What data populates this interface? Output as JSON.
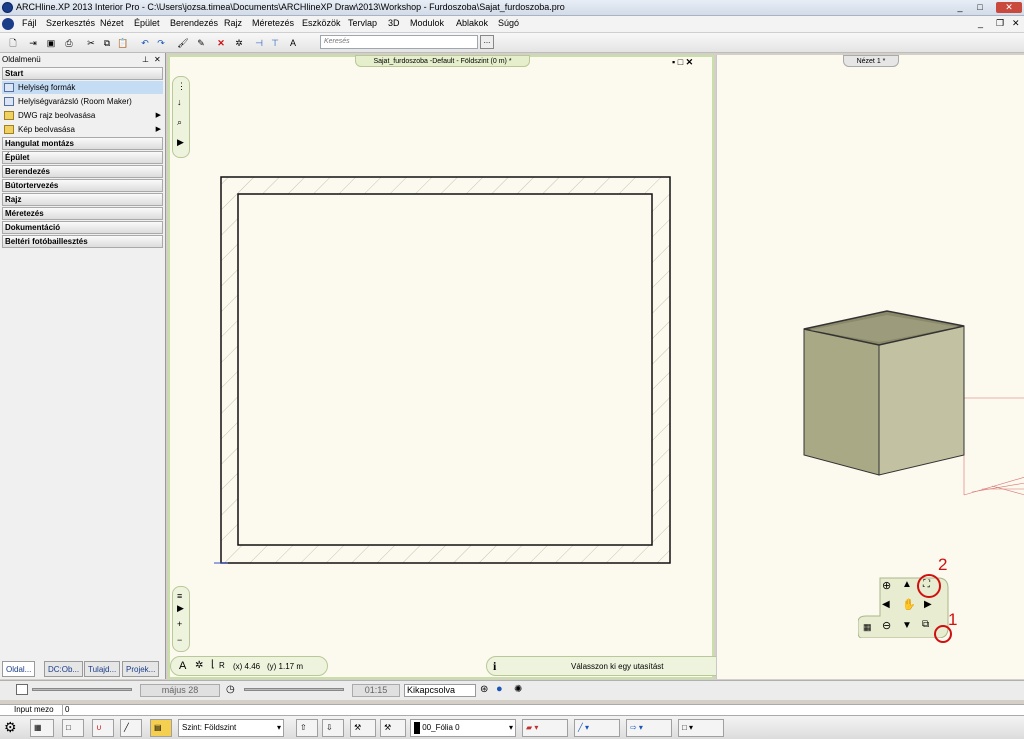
{
  "window": {
    "title": "ARCHline.XP 2013 Interior Pro - C:\\Users\\jozsa.timea\\Documents\\ARCHlineXP Draw\\2013\\Workshop - Furdoszoba\\Sajat_furdoszoba.pro",
    "minimize": "_",
    "maximize": "□",
    "close": "✕"
  },
  "menu": [
    "Fájl",
    "Szerkesztés",
    "Nézet",
    "Épület",
    "Berendezés",
    "Rajz",
    "Méretezés",
    "Eszközök",
    "Tervlap",
    "3D",
    "Modulok",
    "Ablakok",
    "Súgó"
  ],
  "toolbar": {
    "search_placeholder": "Keresés",
    "search_button": "..."
  },
  "sidebar": {
    "title": "Oldalmenü",
    "pin": "⊥",
    "close": "✕",
    "start_section": "Start",
    "items": [
      {
        "label": "Helyiség formák",
        "submenu": ""
      },
      {
        "label": "Helyiségvarázsló (Room Maker)",
        "submenu": ""
      },
      {
        "label": "DWG rajz beolvasása",
        "submenu": "▶"
      },
      {
        "label": "Kép beolvasása",
        "submenu": "▶"
      }
    ],
    "sections": [
      "Hangulat montázs",
      "Épület",
      "Berendezés",
      "Bútortervezés",
      "Rajz",
      "Méretezés",
      "Dokumentáció",
      "Beltéri fotóbaillesztés"
    ],
    "bottom_tabs": [
      "Oldal...",
      "DC:Ob...",
      "Tulajd...",
      "Projek..."
    ]
  },
  "drawing": {
    "tab_title": "Sajat_furdoszoba -Default - Földszint (0 m) *",
    "coord_x": "(x) 4.46",
    "coord_y": "(y) 1.17 m",
    "coord_r": "R",
    "status": "Válasszon ki egy utasítást",
    "info_icon": "i"
  },
  "view3d": {
    "tab_title": "Nézet 1 *",
    "annotation_1": "1",
    "annotation_2": "2"
  },
  "timebar": {
    "date": "május 28",
    "time": "01:15",
    "shadow_option": "Kikapcsolva"
  },
  "input_field": {
    "label": "Input mezo",
    "value": "0"
  },
  "bottombar": {
    "level_label": "Szint:",
    "level_value": "Földszint",
    "layer_value": "00_Fólia 0"
  },
  "colors": {
    "accent_green": "#c8e0a8",
    "annotation_red": "#d01010",
    "box_fill": "#b8b898"
  }
}
